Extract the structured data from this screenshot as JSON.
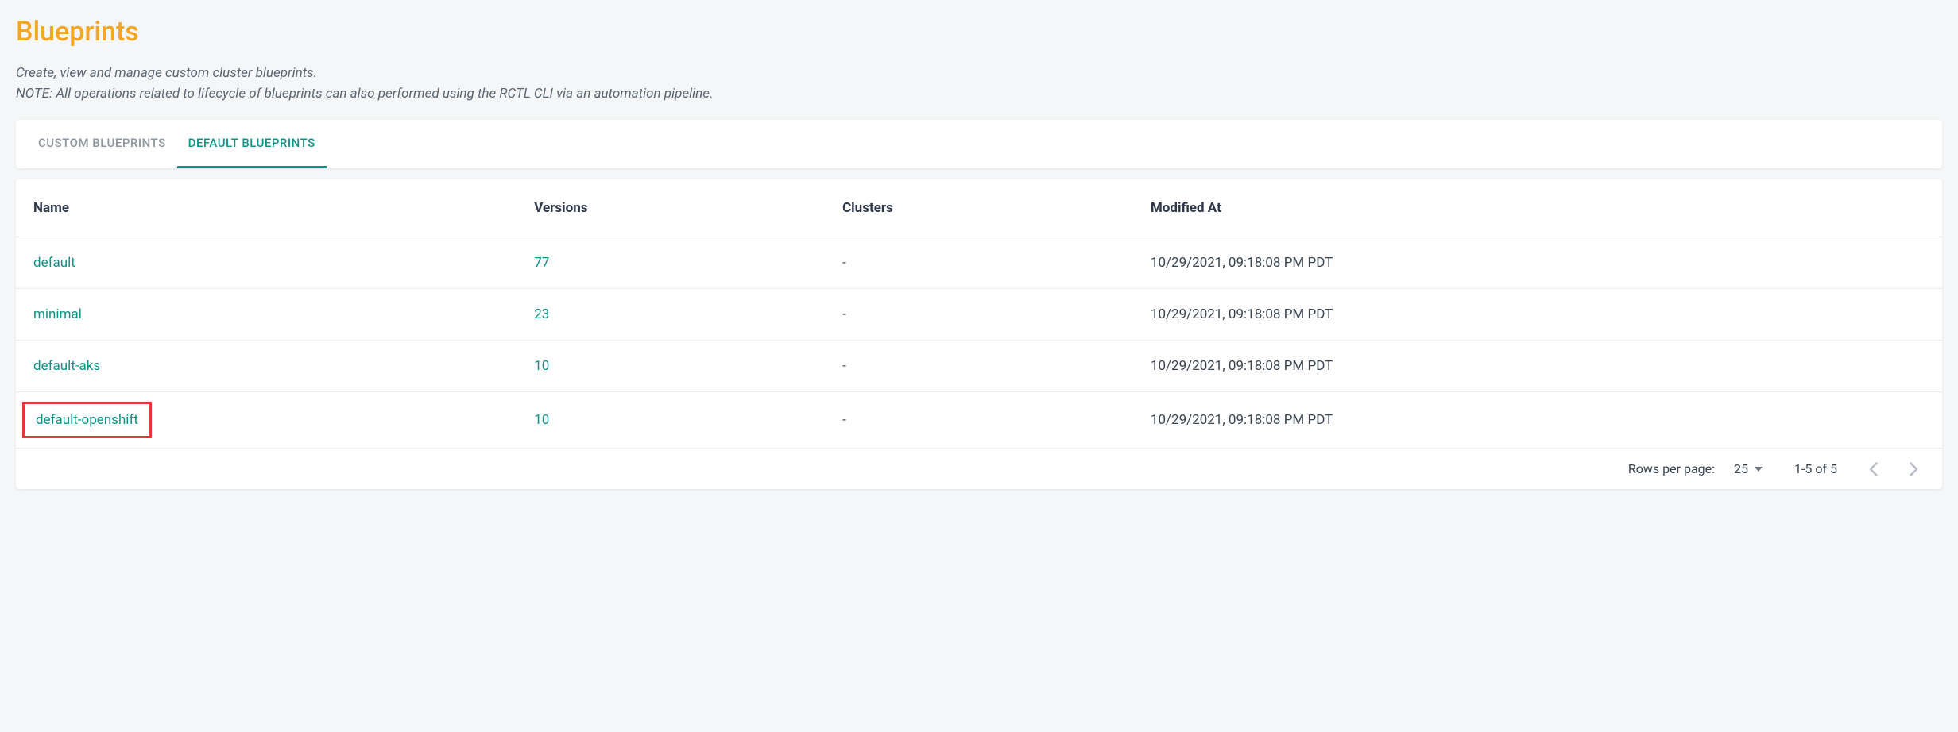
{
  "header": {
    "title": "Blueprints",
    "description_line1": "Create, view and manage custom cluster blueprints.",
    "description_line2": "NOTE: All operations related to lifecycle of blueprints can also performed using the RCTL CLI via an automation pipeline."
  },
  "tabs": {
    "custom": "CUSTOM BLUEPRINTS",
    "default": "DEFAULT BLUEPRINTS"
  },
  "table": {
    "columns": {
      "name": "Name",
      "versions": "Versions",
      "clusters": "Clusters",
      "modified_at": "Modified At"
    },
    "rows": [
      {
        "name": "default",
        "versions": "77",
        "clusters": "-",
        "modified_at": "10/29/2021, 09:18:08 PM PDT",
        "highlighted": false
      },
      {
        "name": "minimal",
        "versions": "23",
        "clusters": "-",
        "modified_at": "10/29/2021, 09:18:08 PM PDT",
        "highlighted": false
      },
      {
        "name": "default-aks",
        "versions": "10",
        "clusters": "-",
        "modified_at": "10/29/2021, 09:18:08 PM PDT",
        "highlighted": false
      },
      {
        "name": "default-openshift",
        "versions": "10",
        "clusters": "-",
        "modified_at": "10/29/2021, 09:18:08 PM PDT",
        "highlighted": true
      }
    ]
  },
  "pagination": {
    "rows_per_page_label": "Rows per page:",
    "rows_per_page_value": "25",
    "range": "1-5 of 5"
  }
}
